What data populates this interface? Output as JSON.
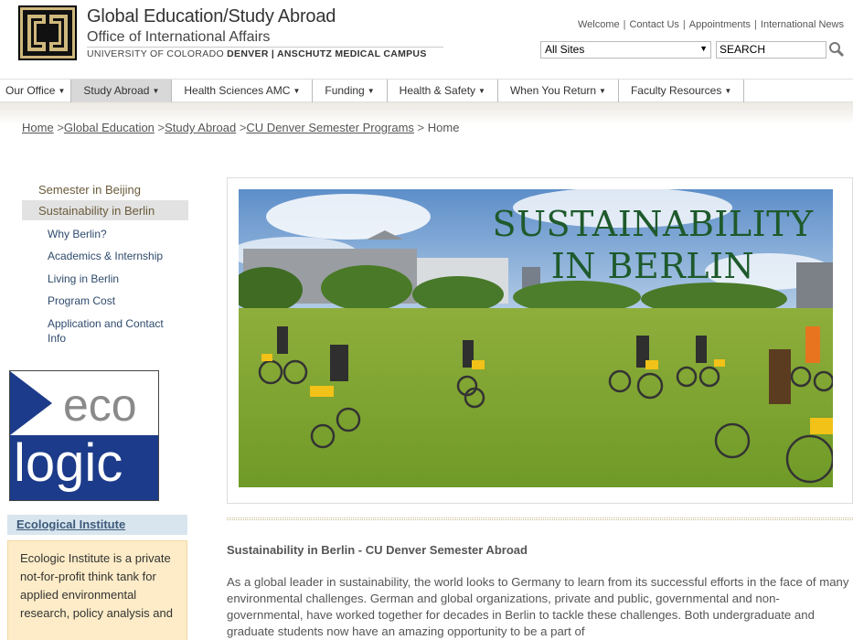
{
  "header": {
    "title": "Global Education/Study Abroad",
    "subtitle": "Office of International Affairs",
    "campus_prefix": "UNIVERSITY OF COLORADO",
    "campus_bold": "DENVER | ANSCHUTZ MEDICAL CAMPUS",
    "logo_letters": "CU"
  },
  "util_links": [
    "Welcome",
    "Contact Us",
    "Appointments",
    "International News"
  ],
  "search": {
    "scope_selected": "All Sites",
    "placeholder": "SEARCH"
  },
  "nav": [
    {
      "label": "Our Office"
    },
    {
      "label": "Study Abroad"
    },
    {
      "label": "Health Sciences AMC"
    },
    {
      "label": "Funding"
    },
    {
      "label": "Health & Safety"
    },
    {
      "label": "When You Return"
    },
    {
      "label": "Faculty Resources"
    }
  ],
  "breadcrumb": {
    "links": [
      "Home",
      "Global Education",
      "Study Abroad",
      "CU Denver Semester Programs"
    ],
    "current": "Home"
  },
  "sidebar": {
    "top_items": [
      "Semester in Beijing",
      "Sustainability in Berlin"
    ],
    "sub_items": [
      "Why Berlin?",
      "Academics & Internship",
      "Living in Berlin",
      "Program Cost",
      "Application and Contact Info"
    ]
  },
  "ecologic": {
    "word1": "eco",
    "word2": "logic",
    "header": "Ecological Institute",
    "description": "Ecologic Institute is a private not-for-profit think tank for applied environmental research, policy analysis and"
  },
  "hero": {
    "title_line1": "SUSTAINABILITY",
    "title_line2": "IN BERLIN"
  },
  "content": {
    "title": "Sustainability in Berlin - CU Denver Semester Abroad",
    "body": "As a global leader in sustainability, the world looks to Germany to learn from its successful efforts in the face of many environmental challenges. German and global organizations, private and public, governmental and non-governmental, have worked together for decades in Berlin to tackle these challenges. Both undergraduate and graduate students now have an amazing opportunity to be a part of"
  },
  "colors": {
    "nav_active": "#d8d8d8",
    "hero_title": "#1e5a2c",
    "sidebar_link": "#2e4a6c",
    "ecologic_blue": "#1c3b8a",
    "callout_bg": "#fdecc7"
  }
}
